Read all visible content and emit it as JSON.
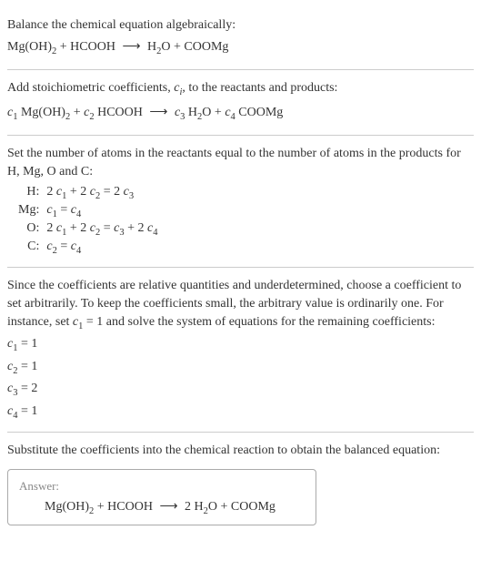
{
  "section1": {
    "title": "Balance the chemical equation algebraically:",
    "equation": "Mg(OH)₂ + HCOOH  ⟶  H₂O + COOMg"
  },
  "section2": {
    "text": "Add stoichiometric coefficients, cᵢ, to the reactants and products:",
    "equation": "c₁ Mg(OH)₂ + c₂ HCOOH  ⟶  c₃ H₂O + c₄ COOMg"
  },
  "section3": {
    "text": "Set the number of atoms in the reactants equal to the number of atoms in the products for H, Mg, O and C:",
    "rows": [
      {
        "el": "H:",
        "eq": "2 c₁ + 2 c₂ = 2 c₃"
      },
      {
        "el": "Mg:",
        "eq": "c₁ = c₄"
      },
      {
        "el": "O:",
        "eq": "2 c₁ + 2 c₂ = c₃ + 2 c₄"
      },
      {
        "el": "C:",
        "eq": "c₂ = c₄"
      }
    ]
  },
  "section4": {
    "text": "Since the coefficients are relative quantities and underdetermined, choose a coefficient to set arbitrarily. To keep the coefficients small, the arbitrary value is ordinarily one. For instance, set c₁ = 1 and solve the system of equations for the remaining coefficients:",
    "lines": [
      "c₁ = 1",
      "c₂ = 1",
      "c₃ = 2",
      "c₄ = 1"
    ]
  },
  "section5": {
    "text": "Substitute the coefficients into the chemical reaction to obtain the balanced equation:",
    "answer_label": "Answer:",
    "answer_eq": "Mg(OH)₂ + HCOOH  ⟶  2 H₂O + COOMg"
  }
}
